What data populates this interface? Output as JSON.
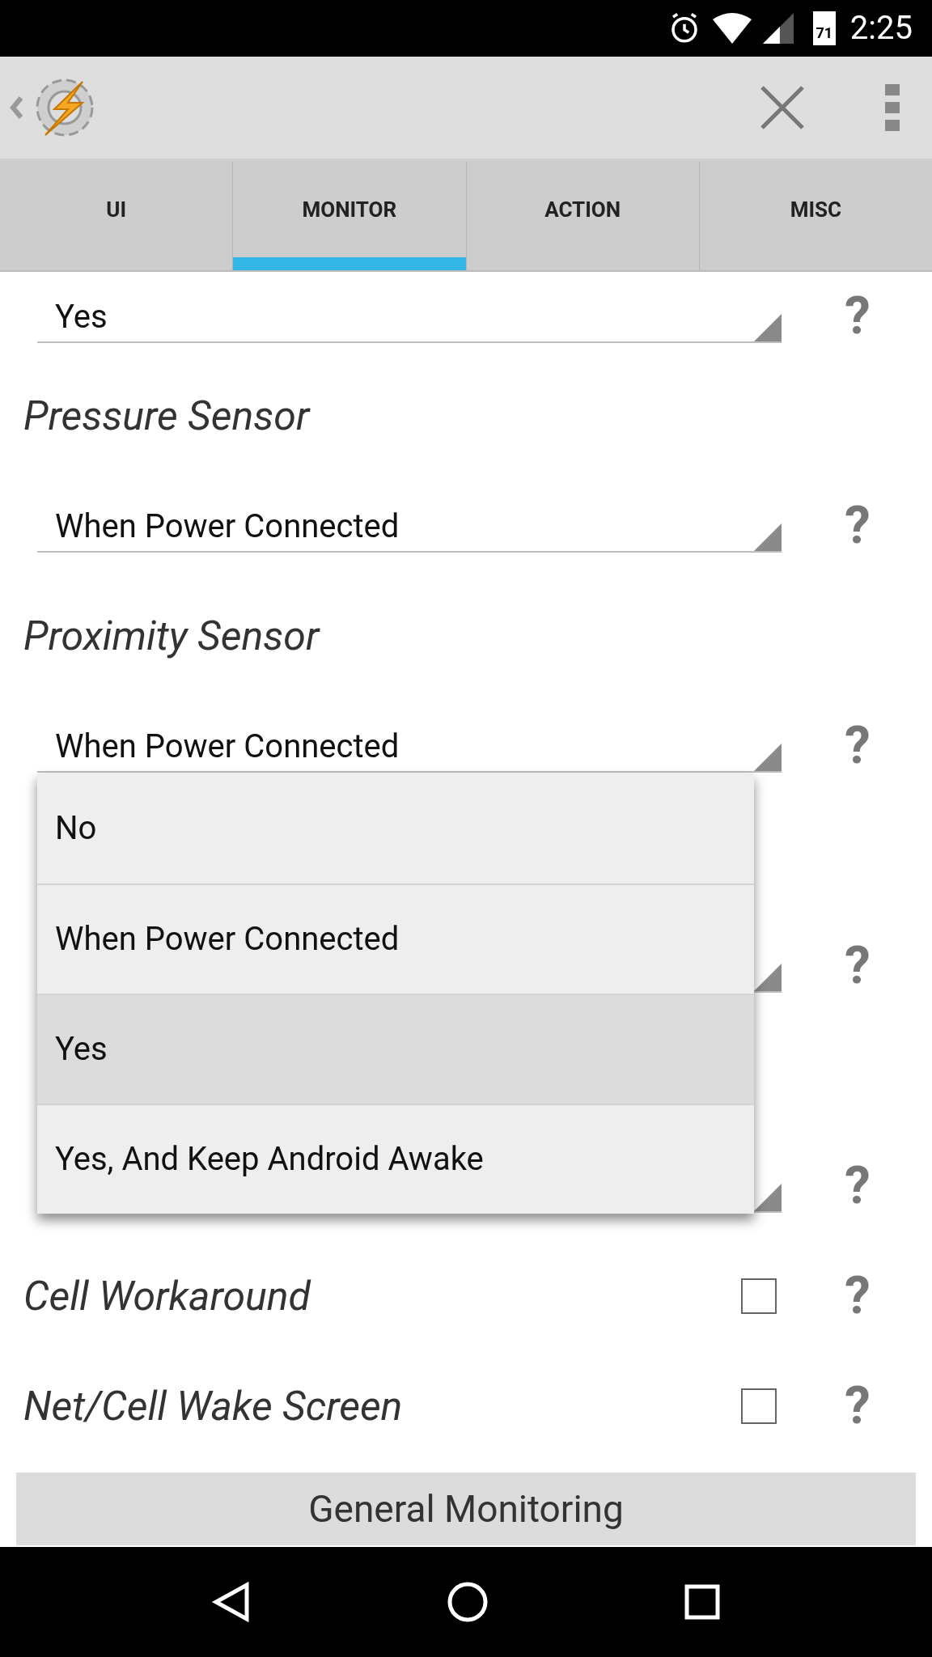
{
  "status_bar": {
    "battery": "71",
    "time": "2:25"
  },
  "tabs": [
    {
      "label": "UI",
      "selected": false
    },
    {
      "label": "MONITOR",
      "selected": true
    },
    {
      "label": "ACTION",
      "selected": false
    },
    {
      "label": "MISC",
      "selected": false
    }
  ],
  "settings": [
    {
      "kind": "select",
      "value": "Yes",
      "help": "?"
    },
    {
      "kind": "heading",
      "text": "Pressure Sensor"
    },
    {
      "kind": "select",
      "value": "When Power Connected",
      "help": "?"
    },
    {
      "kind": "heading",
      "text": "Proximity Sensor"
    },
    {
      "kind": "select",
      "value": "When Power Connected",
      "help": "?"
    },
    {
      "kind": "heading"
    },
    {
      "kind": "select",
      "help": "?"
    },
    {
      "kind": "heading"
    },
    {
      "kind": "select",
      "help": "?"
    },
    {
      "kind": "checkbox",
      "text": "Cell Workaround",
      "checked": false,
      "help": "?"
    },
    {
      "kind": "checkbox",
      "text": "Net/Cell Wake Screen",
      "checked": false,
      "help": "?"
    }
  ],
  "dropdown": [
    {
      "label": "No",
      "selected": false
    },
    {
      "label": "When Power Connected",
      "selected": false
    },
    {
      "label": "Yes",
      "selected": true
    },
    {
      "label": "Yes, And Keep Android Awake",
      "selected": false
    }
  ],
  "section_button": "General Monitoring"
}
